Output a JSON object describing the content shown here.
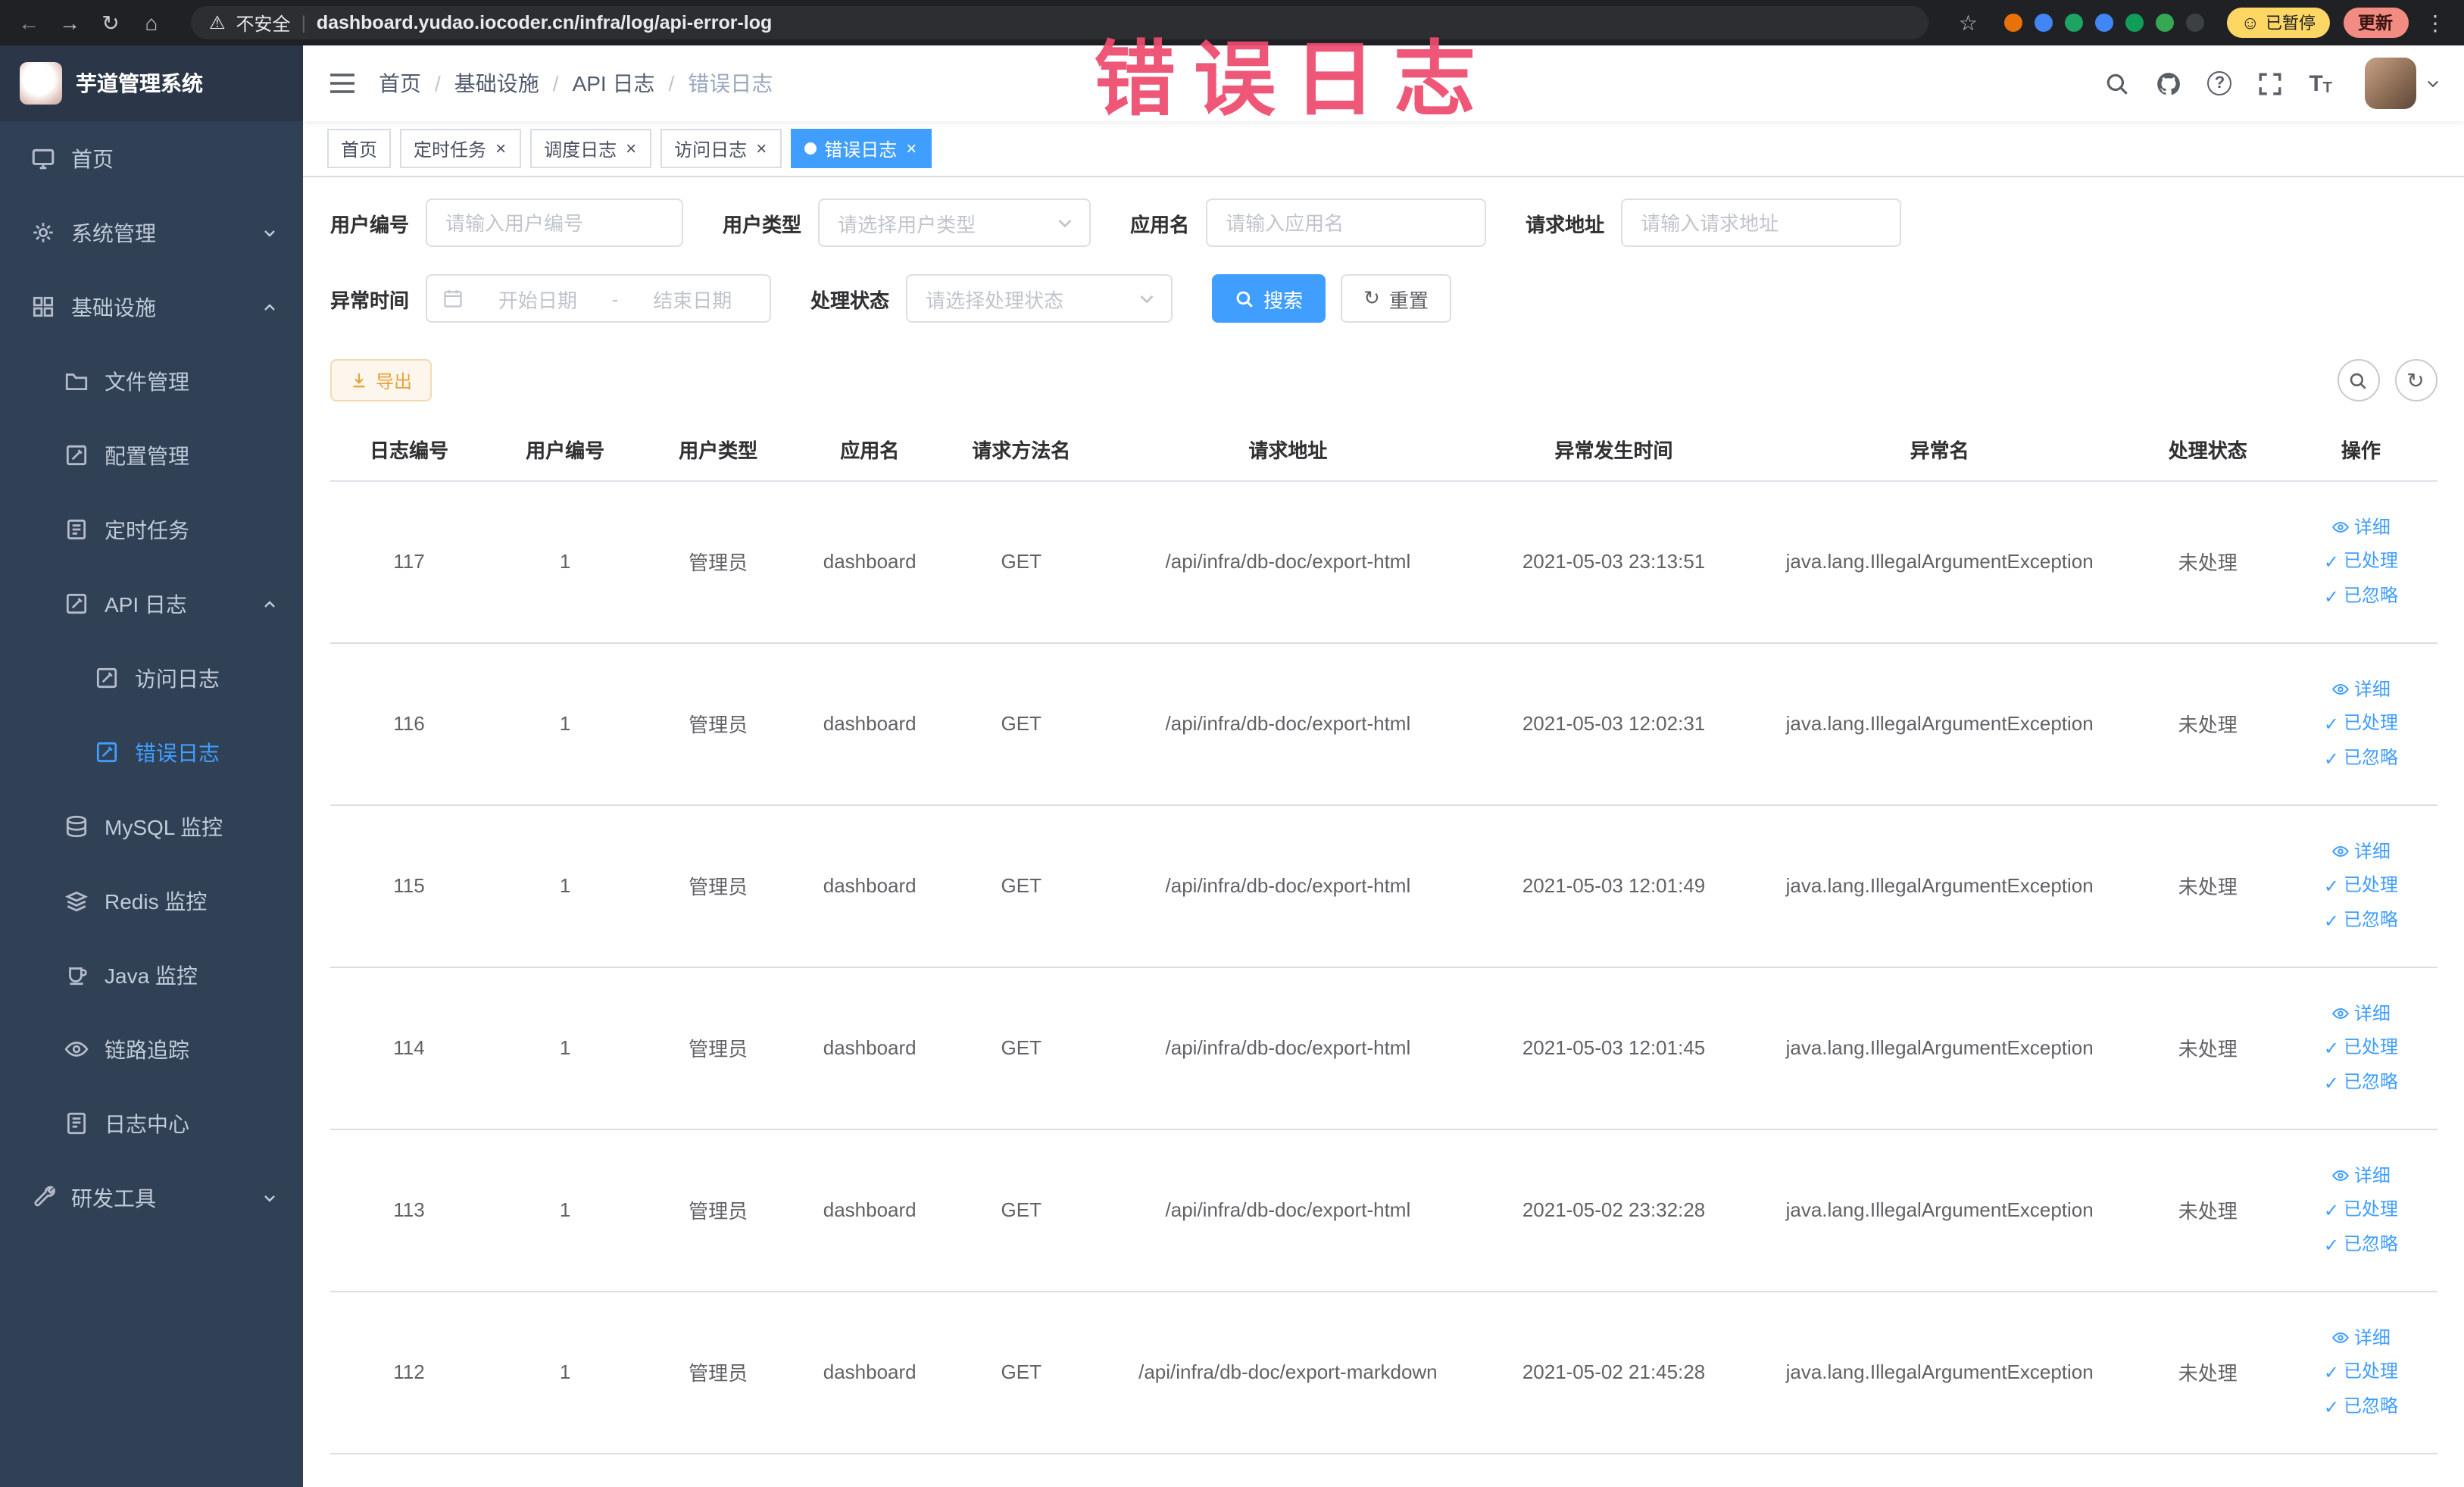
{
  "watermark": "错误日志",
  "colors": {
    "primary": "#409EFF",
    "sidebar_bg": "#304156",
    "active_tab": "#409EFF",
    "warning": "#E6A23C",
    "watermark": "#EE4B6E"
  },
  "browser": {
    "security_label": "不安全",
    "url": "dashboard.yudao.iocoder.cn/infra/log/api-error-log",
    "paused_badge": "已暂停",
    "update_label": "更新",
    "extension_colors": [
      "#e8710a",
      "#4285f4",
      "#1ea362",
      "#4285f4",
      "#0f9d58",
      "#34a853",
      "#3c4043"
    ]
  },
  "sidebar": {
    "logo_title": "芋道管理系统",
    "menu": [
      {
        "label": "首页"
      },
      {
        "label": "系统管理"
      },
      {
        "label": "基础设施"
      },
      {
        "label": "文件管理"
      },
      {
        "label": "配置管理"
      },
      {
        "label": "定时任务"
      },
      {
        "label": "API 日志"
      },
      {
        "label": "访问日志"
      },
      {
        "label": "错误日志"
      },
      {
        "label": "MySQL 监控"
      },
      {
        "label": "Redis 监控"
      },
      {
        "label": "Java 监控"
      },
      {
        "label": "链路追踪"
      },
      {
        "label": "日志中心"
      },
      {
        "label": "研发工具"
      }
    ]
  },
  "header": {
    "breadcrumb": [
      "首页",
      "基础设施",
      "API 日志",
      "错误日志"
    ]
  },
  "tabs": [
    {
      "label": "首页",
      "active": false,
      "closable": false
    },
    {
      "label": "定时任务",
      "active": false,
      "closable": true
    },
    {
      "label": "调度日志",
      "active": false,
      "closable": true
    },
    {
      "label": "访问日志",
      "active": false,
      "closable": true
    },
    {
      "label": "错误日志",
      "active": true,
      "closable": true
    }
  ],
  "filters": {
    "user_id": {
      "label": "用户编号",
      "placeholder": "请输入用户编号"
    },
    "user_type": {
      "label": "用户类型",
      "placeholder": "请选择用户类型"
    },
    "app_name": {
      "label": "应用名",
      "placeholder": "请输入应用名"
    },
    "request_url": {
      "label": "请求地址",
      "placeholder": "请输入请求地址"
    },
    "exception_time": {
      "label": "异常时间",
      "start_placeholder": "开始日期",
      "separator": "-",
      "end_placeholder": "结束日期"
    },
    "process_status": {
      "label": "处理状态",
      "placeholder": "请选择处理状态"
    },
    "search_label": "搜索",
    "reset_label": "重置"
  },
  "toolbar": {
    "export_label": "导出"
  },
  "table": {
    "columns": [
      "日志编号",
      "用户编号",
      "用户类型",
      "应用名",
      "请求方法名",
      "请求地址",
      "异常发生时间",
      "异常名",
      "处理状态",
      "操作"
    ],
    "action_labels": [
      "详细",
      "已处理",
      "已忽略"
    ],
    "rows": [
      {
        "id": "117",
        "user_id": "1",
        "user_type": "管理员",
        "app": "dashboard",
        "method": "GET",
        "url": "/api/infra/db-doc/export-html",
        "time": "2021-05-03 23:13:51",
        "exception": "java.lang.IllegalArgumentException",
        "status": "未处理"
      },
      {
        "id": "116",
        "user_id": "1",
        "user_type": "管理员",
        "app": "dashboard",
        "method": "GET",
        "url": "/api/infra/db-doc/export-html",
        "time": "2021-05-03 12:02:31",
        "exception": "java.lang.IllegalArgumentException",
        "status": "未处理"
      },
      {
        "id": "115",
        "user_id": "1",
        "user_type": "管理员",
        "app": "dashboard",
        "method": "GET",
        "url": "/api/infra/db-doc/export-html",
        "time": "2021-05-03 12:01:49",
        "exception": "java.lang.IllegalArgumentException",
        "status": "未处理"
      },
      {
        "id": "114",
        "user_id": "1",
        "user_type": "管理员",
        "app": "dashboard",
        "method": "GET",
        "url": "/api/infra/db-doc/export-html",
        "time": "2021-05-03 12:01:45",
        "exception": "java.lang.IllegalArgumentException",
        "status": "未处理"
      },
      {
        "id": "113",
        "user_id": "1",
        "user_type": "管理员",
        "app": "dashboard",
        "method": "GET",
        "url": "/api/infra/db-doc/export-html",
        "time": "2021-05-02 23:32:28",
        "exception": "java.lang.IllegalArgumentException",
        "status": "未处理"
      },
      {
        "id": "112",
        "user_id": "1",
        "user_type": "管理员",
        "app": "dashboard",
        "method": "GET",
        "url": "/api/infra/db-doc/export-markdown",
        "time": "2021-05-02 21:45:28",
        "exception": "java.lang.IllegalArgumentException",
        "status": "未处理"
      }
    ]
  }
}
